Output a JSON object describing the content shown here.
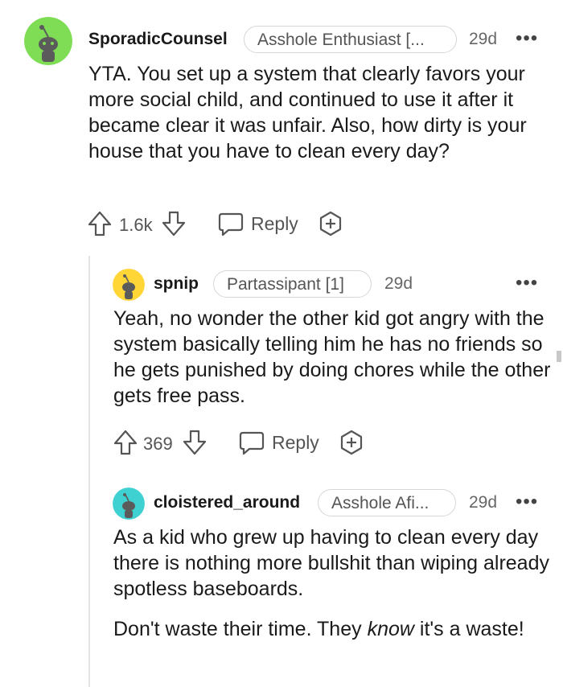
{
  "colors": {
    "avatar_green": "#7fdc55",
    "avatar_yellow": "#ffd635",
    "avatar_teal": "#3fd1d1",
    "text_primary": "#1a1a1b",
    "text_secondary": "#555555"
  },
  "comments": [
    {
      "username": "SporadicCounsel",
      "flair": "Asshole Enthusiast [...",
      "time": "29d",
      "more": "•••",
      "body": [
        "YTA. You set up a system that clearly favors your more social child, and continued to use it after it became clear it was unfair. Also, how dirty is your house that you have to clean every day?"
      ],
      "votes": "1.6k",
      "reply_label": "Reply"
    },
    {
      "username": "spnip",
      "flair": "Partassipant [1]",
      "time": "29d",
      "more": "•••",
      "body": [
        "Yeah, no wonder the other kid got angry with the system basically telling him he has no friends so he gets punished by doing chores while the other gets free pass."
      ],
      "votes": "369",
      "reply_label": "Reply"
    },
    {
      "username": "cloistered_around",
      "flair": "Asshole Afi...",
      "time": "29d",
      "more": "•••",
      "body": [
        "As a kid who grew up having to clean every day there is nothing more bullshit than wiping already spotless baseboards."
      ],
      "body2": {
        "before": "Don't waste their time. They ",
        "emphasis": "know",
        "after": " it's a waste!"
      }
    }
  ]
}
